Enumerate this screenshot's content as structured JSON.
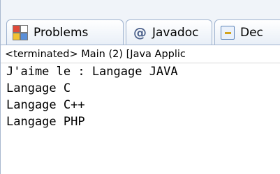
{
  "tabs": [
    {
      "label": "Problems",
      "icon": "problems-icon"
    },
    {
      "label": "Javadoc",
      "icon": "at-icon"
    },
    {
      "label": "Dec",
      "icon": "declaration-icon"
    }
  ],
  "status_line": "<terminated> Main (2) [Java Applic",
  "console": {
    "lines": [
      "J'aime le : Langage JAVA",
      "Langage C",
      "Langage C++",
      "Langage PHP"
    ]
  }
}
